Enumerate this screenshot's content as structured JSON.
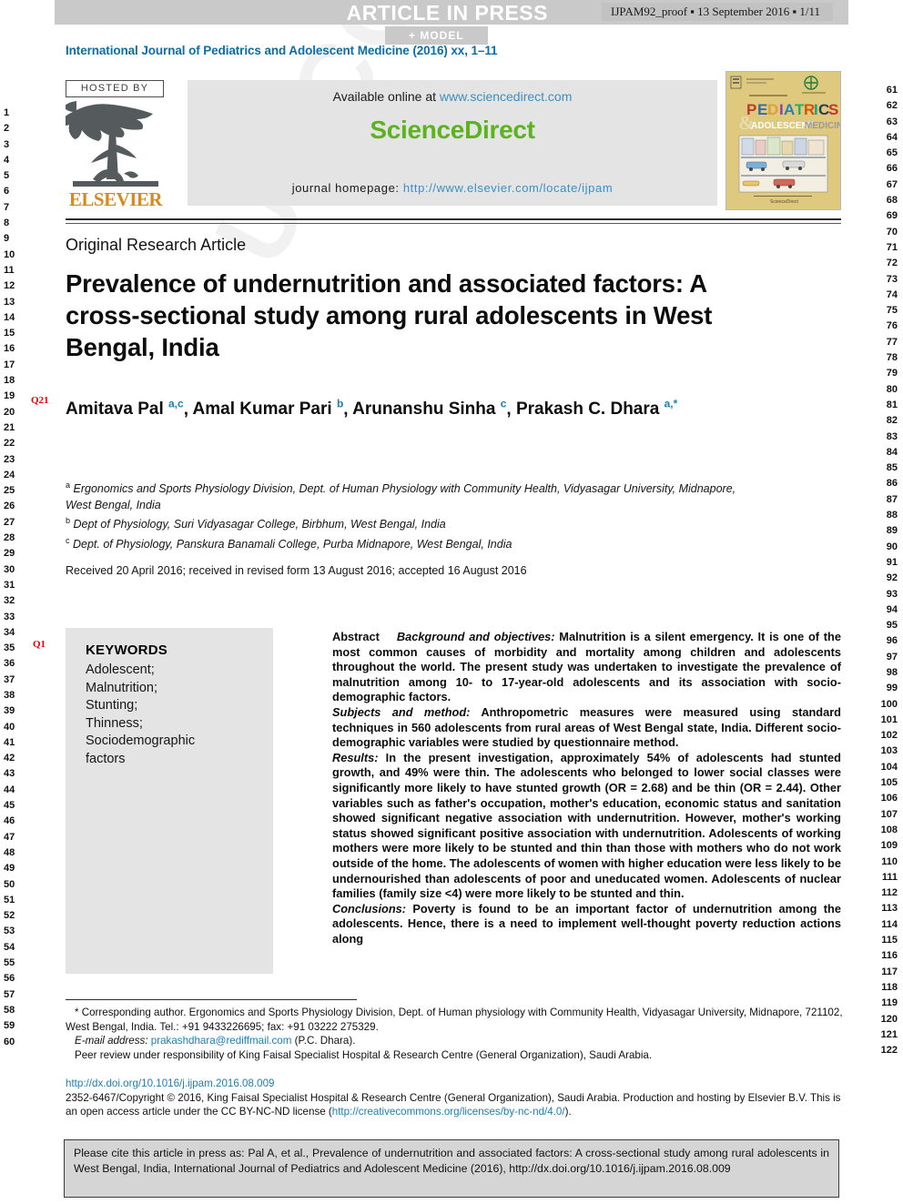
{
  "banner": {
    "article_in_press": "ARTICLE IN PRESS",
    "proof_tag": "IJPAM92_proof ▪ 13 September 2016 ▪ 1/11",
    "model_label": "+ MODEL"
  },
  "journal_line": "International Journal of Pediatrics and Adolescent Medicine (2016) xx, 1–11",
  "masthead": {
    "hosted_by": "HOSTED BY",
    "publisher": "ELSEVIER",
    "available_online_prefix": "Available online at ",
    "sciencedirect_url": "www.sciencedirect.com",
    "sciencedirect_logo": "ScienceDirect",
    "journal_homepage_label": "journal homepage: ",
    "journal_homepage_url": "http://www.elsevier.com/locate/ijpam",
    "cover_title_main": "PEDIATRICS",
    "cover_title_amp": "&",
    "cover_title_sub": "ADOLESCENT MEDICINE",
    "cover_publisher": "ScienceDirect"
  },
  "article": {
    "type": "Original Research Article",
    "title": "Prevalence of undernutrition and associated factors: A cross-sectional study among rural adolescents in West Bengal, India",
    "authors": [
      {
        "name": "Amitava Pal",
        "sup": "a,c",
        "sep": ", "
      },
      {
        "name": "Amal Kumar Pari",
        "sup": "b",
        "sep": ", "
      },
      {
        "name": "Arunanshu Sinha",
        "sup": "c",
        "sep": ", "
      },
      {
        "name": "Prakash C. Dhara",
        "sup": "a,*",
        "sep": ""
      }
    ],
    "affiliations": [
      {
        "mark": "a",
        "text": "Ergonomics and Sports Physiology Division, Dept. of Human Physiology with Community Health, Vidyasagar University, Midnapore, West Bengal, India"
      },
      {
        "mark": "b",
        "text": "Dept of Physiology, Suri Vidyasagar College, Birbhum, West Bengal, India"
      },
      {
        "mark": "c",
        "text": "Dept. of Physiology, Panskura Banamali College, Purba Midnapore, West Bengal, India"
      }
    ],
    "received": "Received 20 April 2016; received in revised form 13 August 2016; accepted 16 August 2016"
  },
  "query_marks": [
    {
      "id": "Q21",
      "label": "Q21"
    },
    {
      "id": "Q1",
      "label": "Q1"
    }
  ],
  "keywords": {
    "heading": "KEYWORDS",
    "items": [
      "Adolescent;",
      "Malnutrition;",
      "Stunting;",
      "Thinness;",
      "Sociodemographic",
      "factors"
    ]
  },
  "abstract": {
    "heading": "Abstract",
    "sections": [
      {
        "label": "Background and objectives:",
        "text": " Malnutrition is a silent emergency. It is one of the most common causes of morbidity and mortality among children and adolescents throughout the world. The present study was undertaken to investigate the prevalence of malnutrition among 10- to 17-year-old adolescents and its association with socio-demographic factors."
      },
      {
        "label": "Subjects and method:",
        "text": " Anthropometric measures were measured using standard techniques in 560 adolescents from rural areas of West Bengal state, India. Different socio-demographic variables were studied by questionnaire method."
      },
      {
        "label": "Results:",
        "text": " In the present investigation, approximately 54% of adolescents had stunted growth, and 49% were thin. The adolescents who belonged to lower social classes were significantly more likely to have stunted growth (OR = 2.68) and be thin (OR = 2.44). Other variables such as father's occupation, mother's education, economic status and sanitation showed significant negative association with undernutrition. However, mother's working status showed significant positive association with undernutrition. Adolescents of working mothers were more likely to be stunted and thin than those with mothers who do not work outside of the home. The adolescents of women with higher education were less likely to be undernourished than adolescents of poor and uneducated women. Adolescents of nuclear families (family size <4) were more likely to be stunted and thin."
      },
      {
        "label": "Conclusions:",
        "text": " Poverty is found to be an important factor of undernutrition among the adolescents. Hence, there is a need to implement well-thought poverty reduction actions along"
      }
    ]
  },
  "footnotes": {
    "corresponding": "* Corresponding author. Ergonomics and Sports Physiology Division, Dept. of Human physiology with Community Health, Vidyasagar University, Midnapore, 721102, West Bengal, India. Tel.: +91 9433226695; fax: +91 03222 275329.",
    "email_label": "E-mail address:",
    "email": "prakashdhara@rediffmail.com",
    "email_suffix": " (P.C. Dhara).",
    "peer_review": "Peer review under responsibility of King Faisal Specialist Hospital & Research Centre (General Organization), Saudi Arabia."
  },
  "publication": {
    "doi_url": "http://dx.doi.org/10.1016/j.ijpam.2016.08.009",
    "copyright_part1": "2352-6467/Copyright © 2016, King Faisal Specialist Hospital & Research Centre (General Organization), Saudi Arabia. Production and hosting by Elsevier B.V. This is an open access article under the CC BY-NC-ND license (",
    "license_url": "http://creativecommons.org/licenses/by-nc-nd/4.0/",
    "copyright_part2": ")."
  },
  "cite_box": "Please cite this article in press as: Pal A, et al., Prevalence of undernutrition and associated factors: A cross-sectional study among rural adolescents in West Bengal, India, International Journal of Pediatrics and Adolescent Medicine (2016), http://dx.doi.org/10.1016/j.ijpam.2016.08.009",
  "line_numbers": {
    "left_start": 1,
    "left_end": 60,
    "right_start": 61,
    "right_end": 122
  },
  "watermark": "UNCORRECTED PROOF",
  "colors": {
    "journal_blue": "#0b6ea8",
    "link_blue": "#1a7fb5",
    "sciencedirect_green": "#5bb31d",
    "elsevier_orange": "#d88a1e",
    "query_red": "#e50000",
    "banner_gray": "#c9c9c9"
  }
}
